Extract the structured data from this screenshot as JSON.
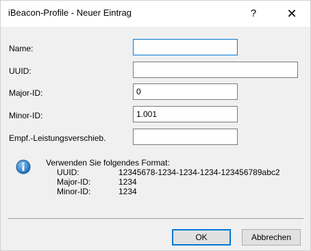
{
  "window": {
    "title": "iBeacon-Profile - Neuer Eintrag",
    "help_glyph": "?",
    "close_glyph": "✕"
  },
  "form": {
    "name": {
      "label": "Name:",
      "value": ""
    },
    "uuid": {
      "label": "UUID:",
      "value": ""
    },
    "major_id": {
      "label": "Major-ID:",
      "value": "0"
    },
    "minor_id": {
      "label": "Minor-ID:",
      "value": "1.001"
    },
    "power_shift": {
      "label": "Empf.-Leistungsverschieb.",
      "value": ""
    }
  },
  "info": {
    "icon": "info-icon",
    "title": "Verwenden Sie folgendes Format:",
    "rows": [
      {
        "key": "UUID:",
        "value": "12345678-1234-1234-1234-123456789abc2"
      },
      {
        "key": "Major-ID:",
        "value": "1234"
      },
      {
        "key": "Minor-ID:",
        "value": "1234"
      }
    ]
  },
  "buttons": {
    "ok": "OK",
    "cancel": "Abbrechen"
  },
  "colors": {
    "dialog_background": "#f0f0f0",
    "focus_border": "#0078d7",
    "info_icon_fill": "#1d6fb8"
  }
}
